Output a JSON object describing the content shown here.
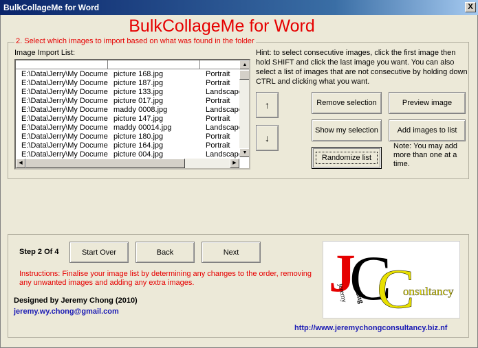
{
  "window": {
    "title": "BulkCollageMe for Word",
    "close_glyph": "X"
  },
  "app_title": "BulkCollageMe for Word",
  "import_group": {
    "legend": "2. Select which images to import based on what was found in the folder",
    "list_label": "Image Import List:",
    "rows": [
      [
        "E:\\Data\\Jerry\\My Docume",
        "picture 168.jpg",
        "Portrait"
      ],
      [
        "E:\\Data\\Jerry\\My Docume",
        "picture 187.jpg",
        "Portrait"
      ],
      [
        "E:\\Data\\Jerry\\My Docume",
        "picture 133.jpg",
        "Landscape"
      ],
      [
        "E:\\Data\\Jerry\\My Docume",
        "picture 017.jpg",
        "Portrait"
      ],
      [
        "E:\\Data\\Jerry\\My Docume",
        "maddy 0008.jpg",
        "Landscape"
      ],
      [
        "E:\\Data\\Jerry\\My Docume",
        "picture 147.jpg",
        "Portrait"
      ],
      [
        "E:\\Data\\Jerry\\My Docume",
        "maddy 00014.jpg",
        "Landscape"
      ],
      [
        "E:\\Data\\Jerry\\My Docume",
        "picture 180.jpg",
        "Portrait"
      ],
      [
        "E:\\Data\\Jerry\\My Docume",
        "picture 164.jpg",
        "Portrait"
      ],
      [
        "E:\\Data\\Jerry\\My Docume",
        "picture 004.jpg",
        "Landscape"
      ]
    ],
    "hint": "Hint: to select consecutive images, click the first image then hold SHIFT and click the last image you want. You can also select a list of images that are not consecutive by holding down CTRL and clicking what you want.",
    "move_up_glyph": "↑",
    "move_down_glyph": "↓",
    "remove_selection": "Remove selection",
    "preview_image": "Preview image",
    "show_selection": "Show my selection",
    "add_images": "Add images to list",
    "randomize": "Randomize list",
    "note": "Note: You may add more than one at a time."
  },
  "footer": {
    "step": "Step 2 Of 4",
    "start_over": "Start Over",
    "back": "Back",
    "next": "Next",
    "instructions": "Instructions: Finalise your image list by determining any changes to the order, removing any unwanted images and adding any extra images.",
    "designed_by": "Designed by Jeremy Chong  (2010)",
    "email": "jeremy.wy.chong@gmail.com",
    "url": "http://www.jeremychongconsultancy.biz.nf"
  },
  "logo": {
    "letter_j": "J",
    "letter_c1": "C",
    "letter_c2": "C",
    "word": "onsultancy",
    "jeremy": "jeremy",
    "chong": "chong"
  },
  "colors": {
    "accent_red": "#e60000",
    "link_blue": "#1a1ab4",
    "logo_yellow": "#e8e000"
  }
}
